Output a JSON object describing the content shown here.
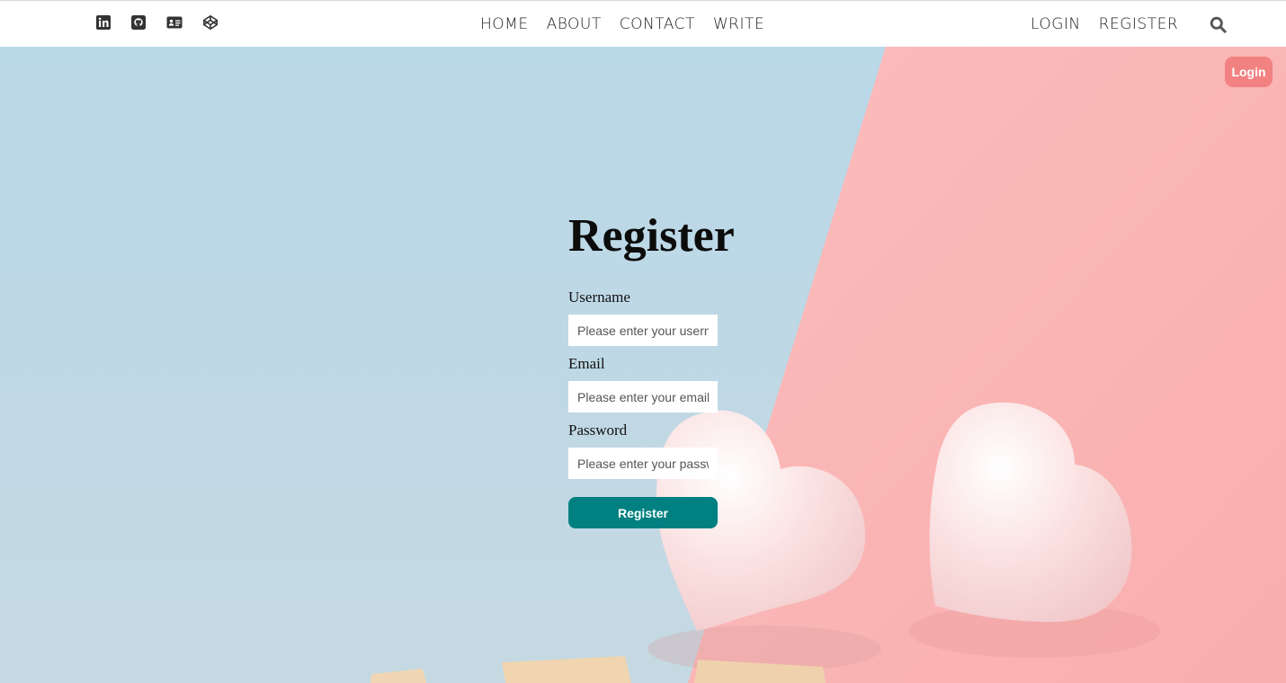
{
  "topbar": {
    "social_icons": [
      "linkedin-icon",
      "github-icon",
      "id-card-icon",
      "codepen-icon"
    ],
    "nav_center": [
      "HOME",
      "ABOUT",
      "CONTACT",
      "WRITE"
    ],
    "nav_right": [
      "LOGIN",
      "REGISTER"
    ],
    "search_icon": "search-icon"
  },
  "corner_login": {
    "label": "Login",
    "color": "#f28282"
  },
  "form": {
    "title": "Register",
    "username_label": "Username",
    "username_placeholder": "Please enter your username...",
    "email_label": "Email",
    "email_placeholder": "Please enter your email...",
    "password_label": "Password",
    "password_placeholder": "Please enter your password...",
    "submit_label": "Register",
    "submit_color": "#008080"
  },
  "background": {
    "left_color": "#bcd9e6",
    "right_color": "#fcb8b8"
  }
}
